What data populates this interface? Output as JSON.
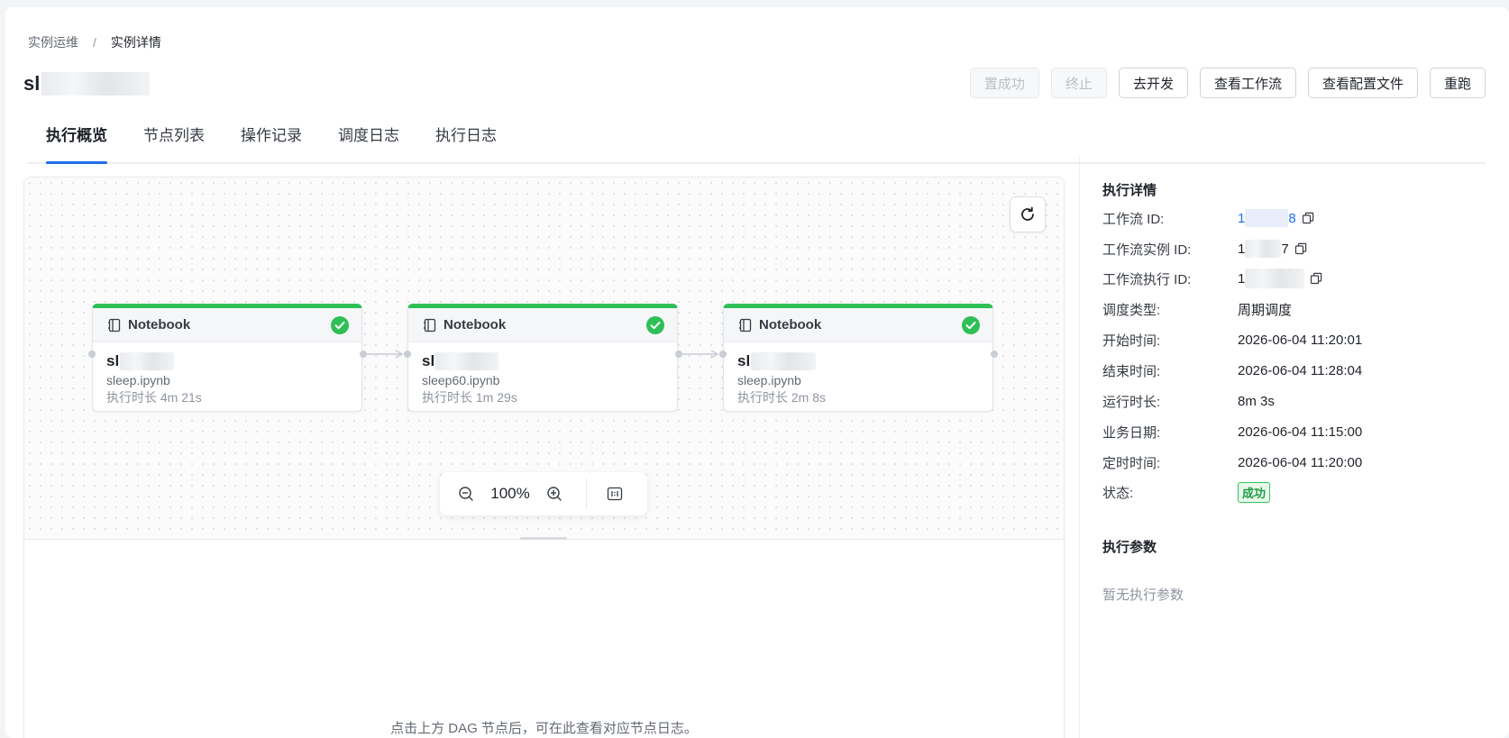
{
  "breadcrumb": {
    "parent": "实例运维",
    "separator": "/",
    "current": "实例详情"
  },
  "title": "sl",
  "actions": [
    {
      "label": "置成功",
      "disabled": true
    },
    {
      "label": "终止",
      "disabled": true
    },
    {
      "label": "去开发",
      "disabled": false
    },
    {
      "label": "查看工作流",
      "disabled": false
    },
    {
      "label": "查看配置文件",
      "disabled": false
    },
    {
      "label": "重跑",
      "disabled": false
    }
  ],
  "tabs": [
    {
      "label": "执行概览",
      "active": true
    },
    {
      "label": "节点列表",
      "active": false
    },
    {
      "label": "操作记录",
      "active": false
    },
    {
      "label": "调度日志",
      "active": false
    },
    {
      "label": "执行日志",
      "active": false
    }
  ],
  "dag": {
    "nodes": [
      {
        "type": "Notebook",
        "name": "sl",
        "file": "sleep.ipynb",
        "duration": "执行时长 4m 21s",
        "status": "success"
      },
      {
        "type": "Notebook",
        "name": "sl",
        "file": "sleep60.ipynb",
        "duration": "执行时长 1m 29s",
        "status": "success"
      },
      {
        "type": "Notebook",
        "name": "sl",
        "file": "sleep.ipynb",
        "duration": "执行时长 2m 8s",
        "status": "success"
      }
    ],
    "zoom": "100%",
    "success_color": "#2fbf57"
  },
  "log_hint": "点击上方 DAG 节点后，可在此查看对应节点日志。",
  "details": {
    "title": "执行详情",
    "rows": [
      {
        "label": "工作流 ID:",
        "value_prefix": "1",
        "value_suffix": "8"
      },
      {
        "label": "工作流实例 ID:",
        "value_prefix": "1",
        "value_suffix": "7"
      },
      {
        "label": "工作流执行 ID:",
        "value_prefix": "1"
      },
      {
        "label": "调度类型:",
        "value": "周期调度"
      },
      {
        "label": "开始时间:",
        "value": "2026-06-04 11:20:01"
      },
      {
        "label": "结束时间:",
        "value": "2026-06-04 11:28:04"
      },
      {
        "label": "运行时长:",
        "value": "8m 3s"
      },
      {
        "label": "业务日期:",
        "value": "2026-06-04 11:15:00"
      },
      {
        "label": "定时时间:",
        "value": "2026-06-04 11:20:00"
      },
      {
        "label": "状态:",
        "value": "成功"
      }
    ]
  },
  "params": {
    "title": "执行参数",
    "empty": "暂无执行参数"
  },
  "colors": {
    "accent": "#1f6feb",
    "success": "#2fbf57"
  }
}
